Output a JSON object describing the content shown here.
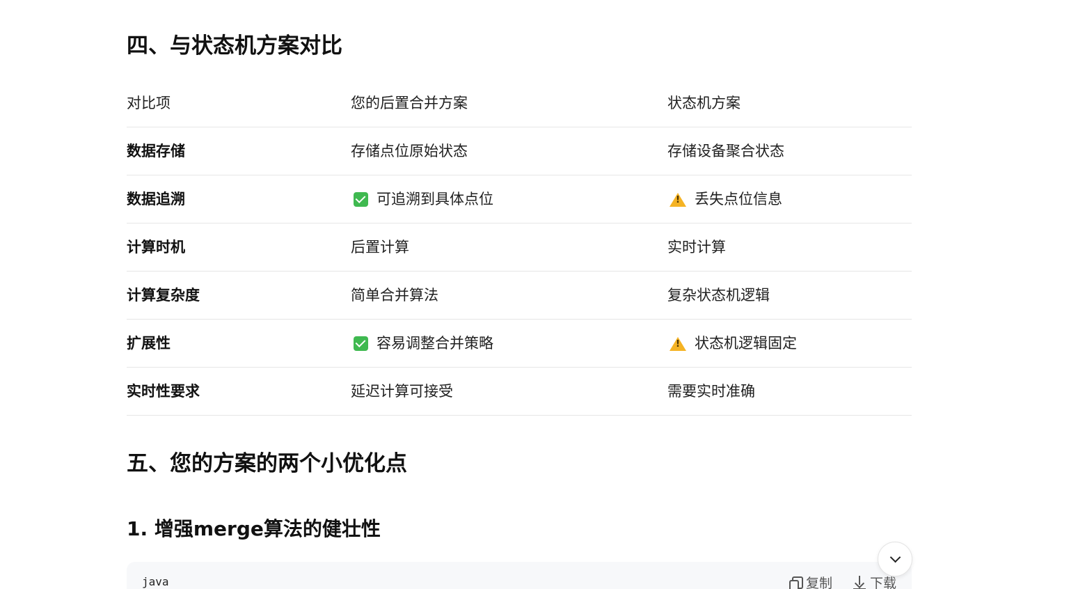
{
  "section4": {
    "title": "四、与状态机方案对比"
  },
  "table": {
    "headers": [
      "对比项",
      "您的后置合并方案",
      "状态机方案"
    ],
    "rows": [
      {
        "item": "数据存储",
        "yours": "存储点位原始状态",
        "yours_icon": "",
        "sm": "存储设备聚合状态",
        "sm_icon": ""
      },
      {
        "item": "数据追溯",
        "yours": "可追溯到具体点位",
        "yours_icon": "check-icon",
        "sm": "丢失点位信息",
        "sm_icon": "warning-icon"
      },
      {
        "item": "计算时机",
        "yours": "后置计算",
        "yours_icon": "",
        "sm": "实时计算",
        "sm_icon": ""
      },
      {
        "item": "计算复杂度",
        "yours": "简单合并算法",
        "yours_icon": "",
        "sm": "复杂状态机逻辑",
        "sm_icon": ""
      },
      {
        "item": "扩展性",
        "yours": "容易调整合并策略",
        "yours_icon": "check-icon",
        "sm": "状态机逻辑固定",
        "sm_icon": "warning-icon"
      },
      {
        "item": "实时性要求",
        "yours": "延迟计算可接受",
        "yours_icon": "",
        "sm": "需要实时准确",
        "sm_icon": ""
      }
    ]
  },
  "section5": {
    "title": "五、您的方案的两个小优化点"
  },
  "subsection1": {
    "title": "1. 增强merge算法的健壮性"
  },
  "codeblock": {
    "lang": "java",
    "copy_label": "复制",
    "download_label": "下载"
  },
  "colors": {
    "check": "#3fb950",
    "warning": "#f5b324",
    "divider": "#e6e6e6",
    "code_bg": "#f7f8fa"
  }
}
